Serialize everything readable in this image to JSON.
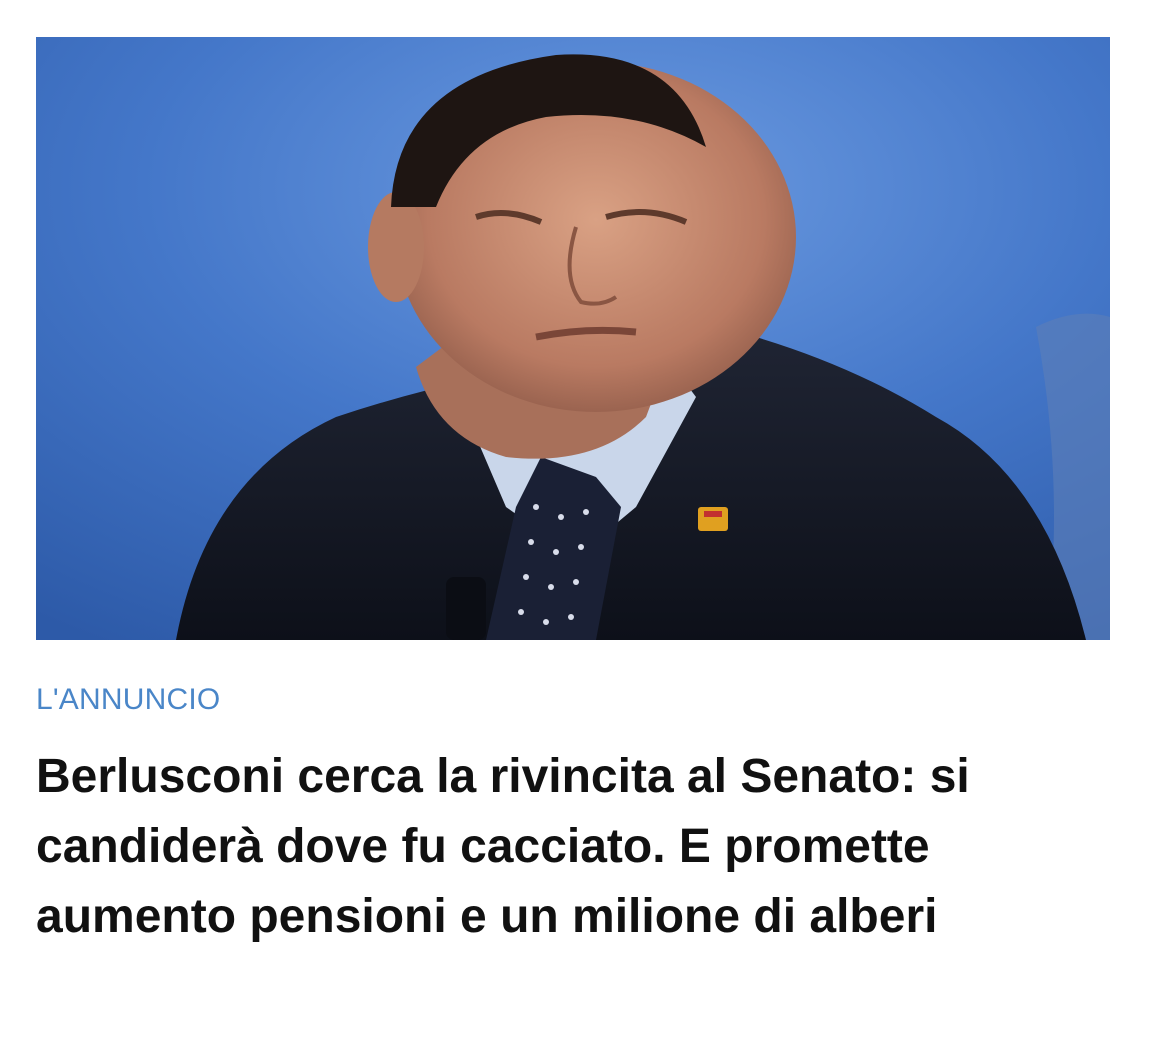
{
  "article": {
    "image": {
      "subject": "photo-portrait-man-in-suit",
      "background_color": "#3f73c7"
    },
    "kicker": "L'ANNUNCIO",
    "kicker_color": "#4a86c8",
    "headline": "Berlusconi cerca la rivincita al Senato: si candiderà dove fu cacciato. E promette aumento pensioni e un milione di alberi"
  }
}
